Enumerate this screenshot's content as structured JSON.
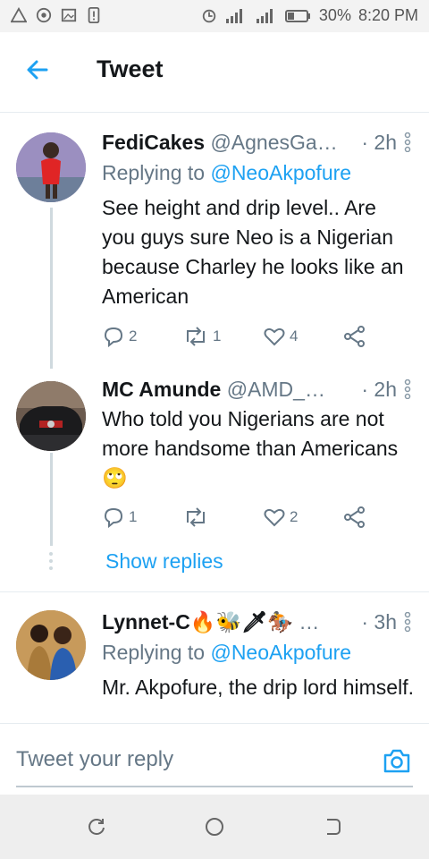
{
  "status": {
    "battery": "30%",
    "time": "8:20 PM"
  },
  "appbar": {
    "title": "Tweet"
  },
  "tweets": [
    {
      "name": "FediCakes",
      "handle": "@AgnesGa…",
      "time": "· 2h",
      "replying_label": "Replying to",
      "replying_handle": "@NeoAkpofure",
      "body": "See height and drip level.. Are you guys sure Neo is a Nigerian because Charley he looks like an American",
      "replies": "2",
      "retweets": "1",
      "likes": "4"
    },
    {
      "name": "MC Amunde",
      "handle": "@AMD_…",
      "time": "· 2h",
      "body": "Who told you Nigerians are not more handsome than Americans 🙄",
      "replies": "1",
      "retweets": "",
      "likes": "2",
      "show_replies": "Show replies"
    },
    {
      "name": "Lynnet-C🔥🐝🗡🏇",
      "handle": "…",
      "time": "· 3h",
      "replying_label": "Replying to",
      "replying_handle": "@NeoAkpofure",
      "body": "Mr. Akpofure, the drip lord himself."
    }
  ],
  "composer": {
    "placeholder": "Tweet your reply"
  },
  "colors": {
    "accent": "#1da1f2",
    "muted": "#657786",
    "text": "#14171a"
  }
}
